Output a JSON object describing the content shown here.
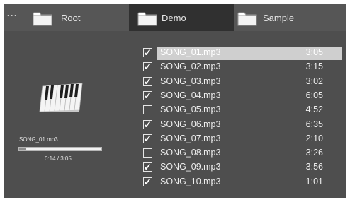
{
  "tabs": [
    {
      "label": "Root",
      "active": false
    },
    {
      "label": "Demo",
      "active": true
    },
    {
      "label": "Sample",
      "active": false
    }
  ],
  "back_label": "···",
  "now_playing": {
    "file": "SONG_01.mp3",
    "time": "0:14 / 3:05",
    "progress": 0.076
  },
  "songs": [
    {
      "name": "SONG_01.mp3",
      "duration": "3:05",
      "checked": true,
      "selected": true
    },
    {
      "name": "SONG_02.mp3",
      "duration": "3:15",
      "checked": true,
      "selected": false
    },
    {
      "name": "SONG_03.mp3",
      "duration": "3:02",
      "checked": true,
      "selected": false
    },
    {
      "name": "SONG_04.mp3",
      "duration": "6:05",
      "checked": true,
      "selected": false
    },
    {
      "name": "SONG_05.mp3",
      "duration": "4:52",
      "checked": false,
      "selected": false
    },
    {
      "name": "SONG_06.mp3",
      "duration": "6:35",
      "checked": true,
      "selected": false
    },
    {
      "name": "SONG_07.mp3",
      "duration": "2:10",
      "checked": true,
      "selected": false
    },
    {
      "name": "SONG_08.mp3",
      "duration": "3:26",
      "checked": false,
      "selected": false
    },
    {
      "name": "SONG_09.mp3",
      "duration": "3:56",
      "checked": true,
      "selected": false
    },
    {
      "name": "SONG_10.mp3",
      "duration": "1:01",
      "checked": true,
      "selected": false
    }
  ],
  "colors": {
    "background": "#4e4e4e",
    "tabbar": "#565656",
    "active_tab": "#303030",
    "selection": "#cfcfcf"
  }
}
